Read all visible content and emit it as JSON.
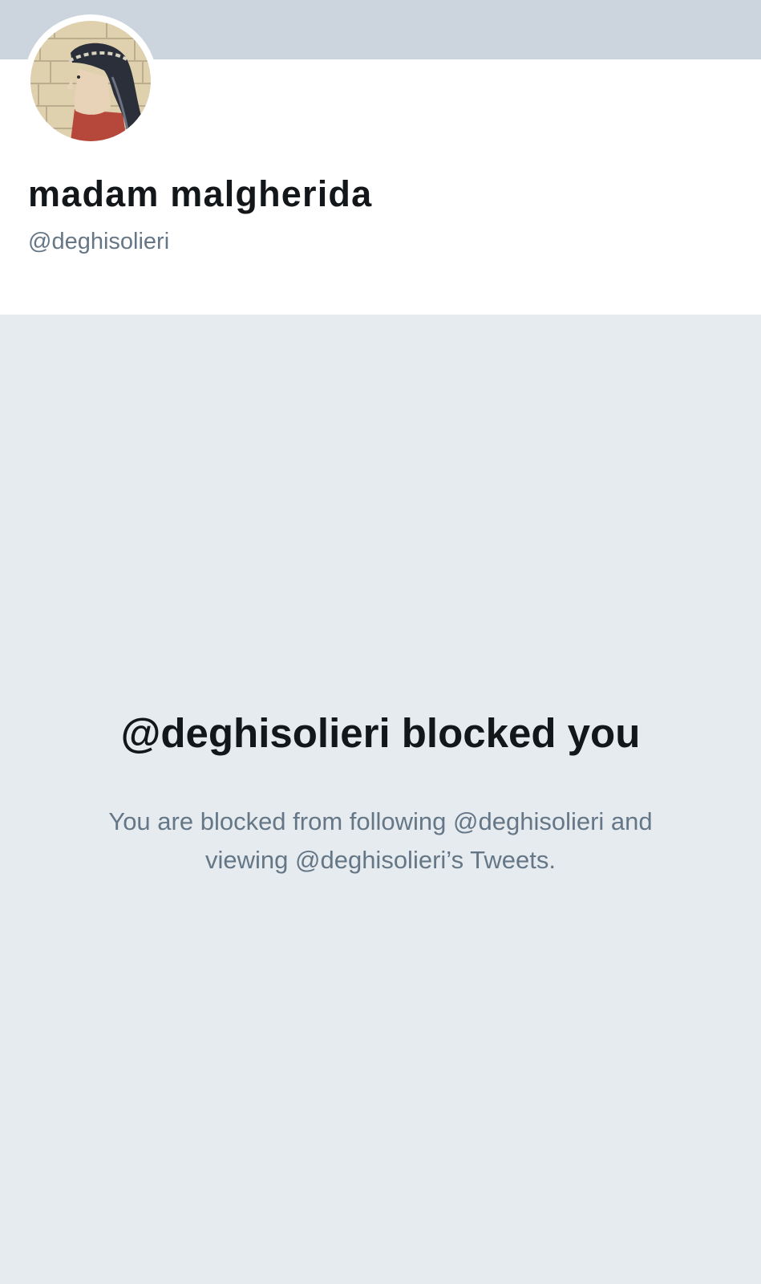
{
  "profile": {
    "display_name": "madam malgherida",
    "handle": "@deghisolieri",
    "avatar_icon": "avatar-portrait"
  },
  "blocked": {
    "title": "@deghisolieri blocked you",
    "message": "You are blocked from following @deghisolieri and viewing @deghisolieri’s Tweets."
  },
  "colors": {
    "banner": "#ccd5de",
    "card": "#ffffff",
    "background": "#e6ebf0",
    "primary_text": "#14171a",
    "secondary_text": "#657786"
  }
}
